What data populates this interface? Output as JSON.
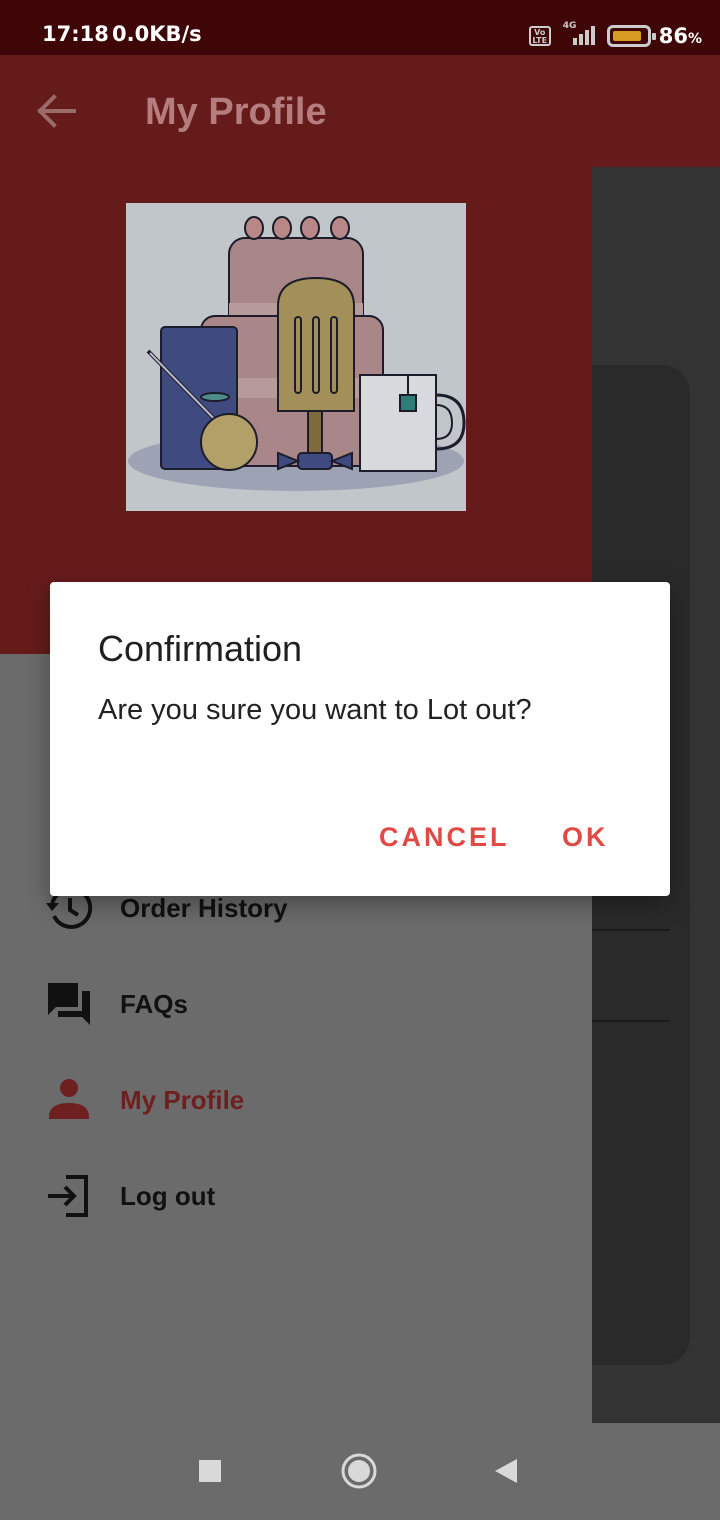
{
  "status_bar": {
    "time": "17:18",
    "network_speed": "0.0KB/s",
    "volte": "Vo LTE",
    "network_type": "4G",
    "battery_percent": "86",
    "battery_unit": "%",
    "battery_level": 0.86,
    "battery_color": "#d79b24"
  },
  "app_bar": {
    "title": "My Profile",
    "back_icon": "arrow-back-icon"
  },
  "drawer": {
    "header_color": "#661b1b",
    "items": [
      {
        "label": "Order History",
        "icon": "history-icon"
      },
      {
        "label": "FAQs",
        "icon": "forum-icon"
      },
      {
        "label": "My Profile",
        "icon": "person-icon",
        "active": true
      },
      {
        "label": "Log out",
        "icon": "logout-icon"
      }
    ]
  },
  "dialog": {
    "title": "Confirmation",
    "message": "Are you sure you want to Lot out?",
    "cancel_label": "CANCEL",
    "ok_label": "OK",
    "accent_color": "#e04a45"
  },
  "nav_bar": {
    "buttons": [
      "recents-icon",
      "home-icon",
      "back-icon"
    ]
  }
}
